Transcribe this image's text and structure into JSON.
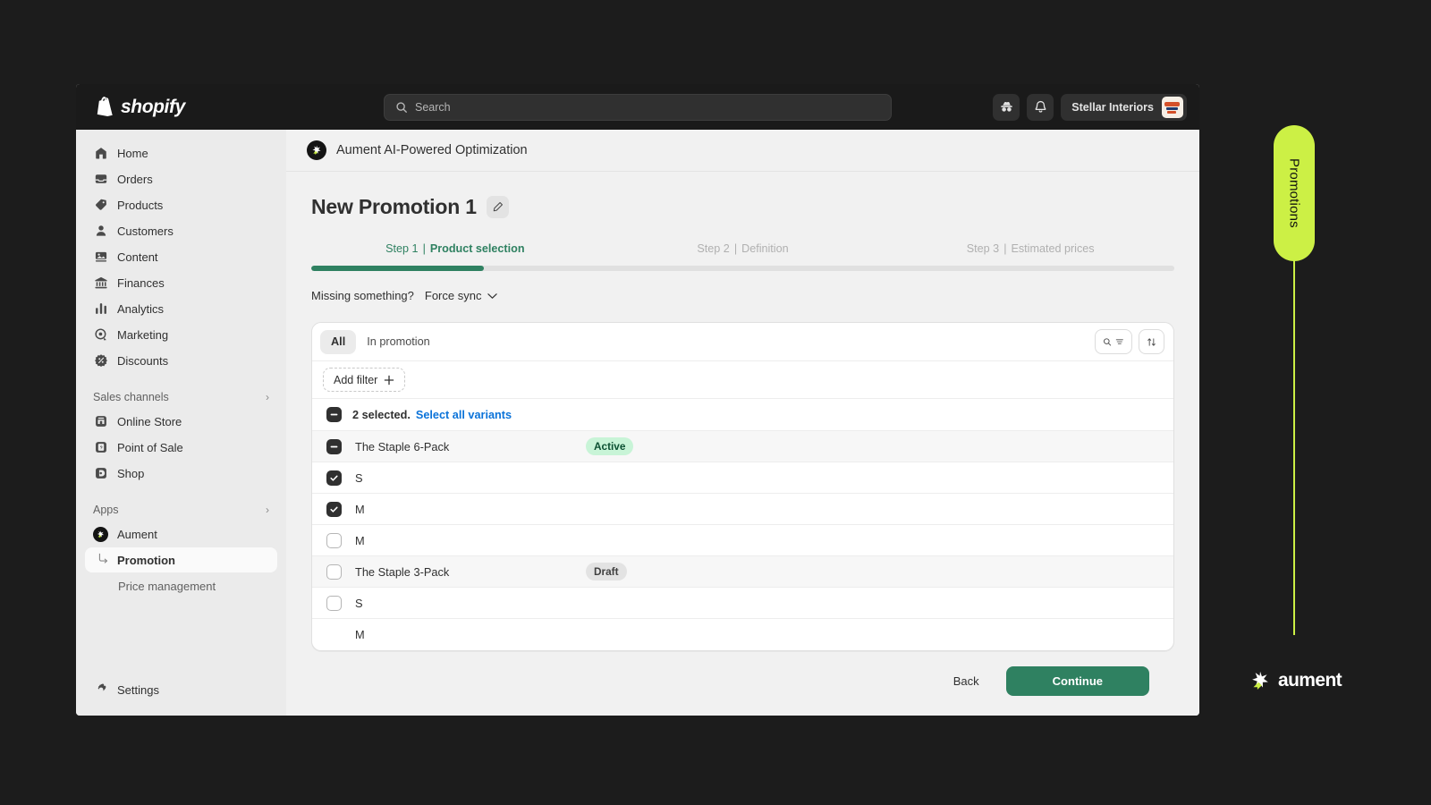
{
  "topbar": {
    "brand": "shopify",
    "search_placeholder": "Search",
    "store_name": "Stellar Interiors",
    "icons": [
      "incognito-icon",
      "bell-icon"
    ]
  },
  "sidebar": {
    "items": [
      {
        "label": "Home",
        "icon": "home-icon"
      },
      {
        "label": "Orders",
        "icon": "orders-inbox-icon"
      },
      {
        "label": "Products",
        "icon": "tag-icon"
      },
      {
        "label": "Customers",
        "icon": "person-icon"
      },
      {
        "label": "Content",
        "icon": "image-icon"
      },
      {
        "label": "Finances",
        "icon": "bank-icon"
      },
      {
        "label": "Analytics",
        "icon": "bar-chart-icon"
      },
      {
        "label": "Marketing",
        "icon": "target-icon"
      },
      {
        "label": "Discounts",
        "icon": "discount-burst-icon"
      }
    ],
    "sales_channels": {
      "title": "Sales channels",
      "items": [
        {
          "label": "Online Store",
          "icon": "storefront-icon"
        },
        {
          "label": "Point of Sale",
          "icon": "pos-icon"
        },
        {
          "label": "Shop",
          "icon": "shop-bag-icon"
        }
      ]
    },
    "apps": {
      "title": "Apps",
      "items": [
        {
          "label": "Aument",
          "icon": "aument-icon"
        },
        {
          "label": "Promotion",
          "icon": "subnav-arrow-icon",
          "active": true
        },
        {
          "label": "Price management",
          "icon": ""
        }
      ]
    },
    "settings": {
      "label": "Settings",
      "icon": "gear-icon"
    }
  },
  "app_header": {
    "title": "Aument AI-Powered Optimization",
    "icon": "aument-icon"
  },
  "page": {
    "title": "New Promotion 1",
    "edit_icon": "pencil-icon",
    "steps": [
      {
        "number": "Step 1",
        "label": "Product selection",
        "active": true
      },
      {
        "number": "Step 2",
        "label": "Definition",
        "active": false
      },
      {
        "number": "Step 3",
        "label": "Estimated prices",
        "active": false
      }
    ],
    "progress_percent": 20,
    "sync": {
      "question": "Missing something?",
      "action": "Force sync",
      "chevron_icon": "chevron-down-icon"
    }
  },
  "table": {
    "tabs": [
      {
        "label": "All",
        "selected": true
      },
      {
        "label": "In promotion",
        "selected": false
      }
    ],
    "toolbar_icons": [
      "search-filter-icon",
      "sort-icon"
    ],
    "add_filter": {
      "label": "Add filter",
      "icon": "plus-icon"
    },
    "selection": {
      "count_text": "2 selected.",
      "link_text": "Select all variants",
      "checkbox_state": "indeterminate"
    },
    "rows": [
      {
        "name": "The Staple 6-Pack",
        "status": "Active",
        "status_type": "active",
        "checkbox": "indeterminate",
        "type": "product"
      },
      {
        "name": "S",
        "status": "",
        "status_type": "",
        "checkbox": "checked",
        "type": "variant"
      },
      {
        "name": "M",
        "status": "",
        "status_type": "",
        "checkbox": "checked",
        "type": "variant"
      },
      {
        "name": "M",
        "status": "",
        "status_type": "",
        "checkbox": "empty",
        "type": "variant"
      },
      {
        "name": "The Staple 3-Pack",
        "status": "Draft",
        "status_type": "draft",
        "checkbox": "empty",
        "type": "product"
      },
      {
        "name": "S",
        "status": "",
        "status_type": "",
        "checkbox": "empty",
        "type": "variant"
      },
      {
        "name": "M",
        "status": "",
        "status_type": "",
        "checkbox": "none",
        "type": "variant"
      }
    ]
  },
  "footer": {
    "back_label": "Back",
    "continue_label": "Continue"
  },
  "overlay": {
    "promotions_tab_label": "Promotions",
    "brand_wordmark": "aument"
  },
  "colors": {
    "accent_green": "#2f8161",
    "lime": "#ccf045",
    "link_blue": "#0b73d9",
    "badge_active_bg": "#c8f4d7",
    "badge_active_text": "#0c5132",
    "badge_draft_bg": "#e3e3e3",
    "dark_bg": "#1c1c1c"
  }
}
